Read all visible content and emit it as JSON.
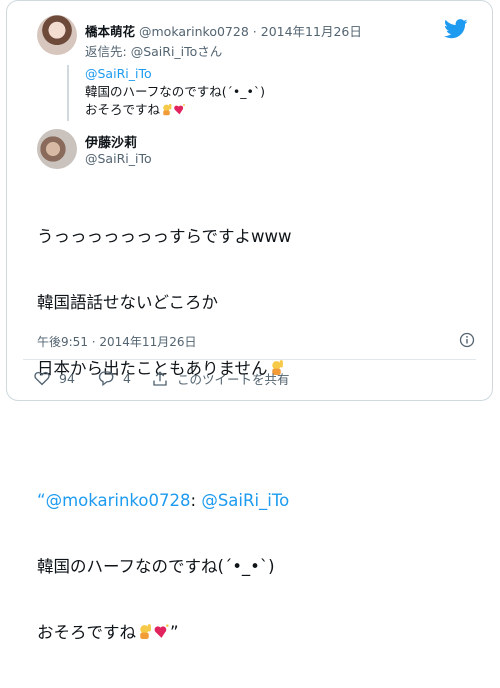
{
  "quoted": {
    "name": "橋本萌花",
    "handle": "@mokarinko0728",
    "separator": "·",
    "date": "2014年11月26日",
    "reply_prefix": "返信先:",
    "reply_to": "@SaiRi_iToさん",
    "body_mention": "@SaiRi_iTo",
    "body_line1": "韓国のハーフなのですね(´•_•`)",
    "body_line2": "おそろですね"
  },
  "author": {
    "name": "伊藤沙莉",
    "handle": "@SaiRi_iTo"
  },
  "tweet": {
    "line1": "うっっっっっっっすらですよwww",
    "line2": "韓国語話せないどころか",
    "line3": "日本から出たこともありません",
    "quote_open": "“",
    "quote_mention1": "@mokarinko0728",
    "quote_colon": ":",
    "quote_mention2": "@SaiRi_iTo",
    "line5": "韓国のハーフなのですね(´•_•`)",
    "line6_prefix": "おそろですね",
    "quote_close": "”"
  },
  "timestamp": "午後9:51 · 2014年11月26日",
  "actions": {
    "likes": "94",
    "replies": "4",
    "share_label": "このツイートを共有"
  },
  "colors": {
    "accent": "#1d9bf0",
    "like": "#536471",
    "heart_emoji": "#e0245e"
  },
  "icons": [
    "twitter-bird-icon",
    "raising-hand-emoji",
    "sparkling-heart-emoji",
    "info-icon",
    "heart-icon",
    "reply-icon",
    "share-icon"
  ]
}
